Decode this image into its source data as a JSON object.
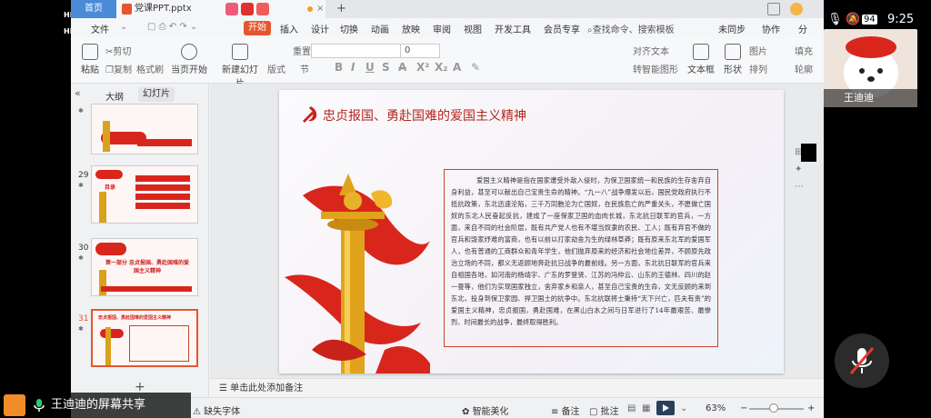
{
  "titlebar": {
    "home_tab": "首页",
    "doc_tab": "党课PPT.pptx",
    "new_tab": "+"
  },
  "menubar": {
    "file": "文件",
    "active_tab": "开始",
    "items": [
      "插入",
      "设计",
      "切换",
      "动画",
      "放映",
      "审阅",
      "视图",
      "开发工具",
      "会员专享"
    ],
    "search": "查找命令、搜索模板",
    "right_items": [
      "未同步",
      "协作",
      "分"
    ]
  },
  "ribbon": {
    "paste": "粘贴",
    "cut": "剪切",
    "copy": "复制",
    "format_painter": "格式刷",
    "play_from_current": "当页开始",
    "new_slide": "新建幻灯片",
    "layout": "版式",
    "section": "节",
    "reset": "重置",
    "font_size": "0",
    "align_text": "对齐文本",
    "smart_graphic": "转智能图形",
    "textbox": "文本框",
    "shape": "形状",
    "picture": "图片",
    "arrange": "排列",
    "fill": "填充",
    "outline": "轮廓"
  },
  "sidepanel": {
    "tab_outline": "大纲",
    "tab_slides": "幻灯片",
    "slides": [
      {
        "num": "",
        "title": ""
      },
      {
        "num": "29",
        "title": "目录"
      },
      {
        "num": "30",
        "title": "第一部分 忠贞报国、勇赴国难的爱国主义精神"
      },
      {
        "num": "31",
        "title": "忠贞报国、勇赴国难的爱国主义精神"
      }
    ]
  },
  "slide": {
    "title": "忠贞报国、勇赴国难的爱国主义精神",
    "body": "爱国主义精神是指在国家遭受外敌入侵时，为保卫国家统一和民族的生存舍弃自身利益，甚至可以献出自己宝贵生命的精神。“九一八”战争爆发以后，国民党政府执行不抵抗政策，东北迅速沦陷，三千万同胞沦为亡国奴，在民族危亡的严重关头，不愿做亡国奴的东北人民奋起反抗，建成了一座保家卫国的血肉长城，东北抗日联军的官兵，一方面，来自不同的社会阶层，既有共产党人也有不堪当奴隶的农民、工人；既有弃官不做的官兵和毁家纾难的富商，也有以前以打家劫舍为生的绿林草莽；既有原来东北军的爱国军人，也有普通的工商群众和青年学生，他们抛弃原来的经济和社会地位差异，不顾原先政治立场的不同，都义无返顾地奔赴抗日战争的最前线。另一方面，东北抗日联军的官兵来自祖国各地，如河南的杨靖宇、广东的罗登贤、江苏的冯仲云、山东的王德林、四川的赵一曼等，他们为实现国家独立，舍弃家乡和亲人，甚至自己宝贵的生命，文无反顾的来到东北，投身到保卫家园、捍卫国土的抗争中。东北抗联将士秉持“天下兴亡，匹夫有责”的爱国主义精神，忠贞报国，勇赴国难，在黑山白水之间与日军进行了14年最艰苦、最惨烈、时间最长的战争，最终取得胜利。"
  },
  "notes": {
    "placeholder": "单击此处添加备注"
  },
  "statusbar": {
    "missing_font": "缺失字体",
    "smart_beautify": "智能美化",
    "notes": "备注",
    "comments": "批注",
    "zoom": "63%",
    "zoom_minus": "−",
    "zoom_plus": "+"
  },
  "overlay": {
    "time": "9:25",
    "battery": "94",
    "video_name": "王迪迪",
    "share_label": "王迪迪的屏幕共享",
    "hl_text": "HD"
  }
}
